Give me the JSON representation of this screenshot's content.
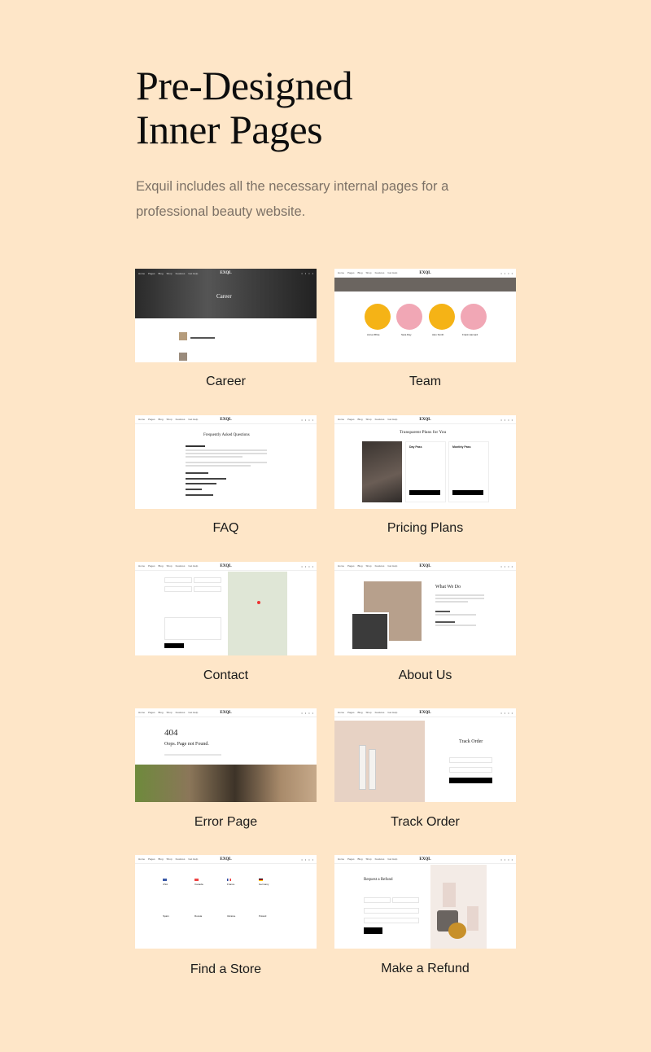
{
  "header": {
    "title_line1": "Pre-Designed",
    "title_line2": "Inner Pages",
    "subtitle": "Exquil includes all the necessary internal pages for a professional beauty website."
  },
  "thumb_nav": {
    "logo": "EXQL",
    "links": [
      "Home",
      "Pages",
      "Blog",
      "Shop",
      "Features",
      "Get Help"
    ]
  },
  "colors": {
    "background": "#fee6c8",
    "title": "#0d0d0d",
    "subtitle": "#7c7166"
  },
  "pages": [
    {
      "label": "Career",
      "heading": "Career"
    },
    {
      "label": "Team",
      "members": [
        "Anna White",
        "Sara Ray",
        "Alex Smith",
        "Frank Harvard"
      ]
    },
    {
      "label": "FAQ",
      "heading": "Frequently Asked Questions"
    },
    {
      "label": "Pricing Plans",
      "heading": "Transparent Plans for You",
      "plans": [
        "Day Pass",
        "Monthly Pass"
      ]
    },
    {
      "label": "Contact"
    },
    {
      "label": "About Us",
      "heading": "What We Do"
    },
    {
      "label": "Error Page",
      "code": "404",
      "message": "Oops. Page not Found."
    },
    {
      "label": "Track Order",
      "heading": "Track Order"
    },
    {
      "label": "Find a Store",
      "countries": [
        "USA",
        "Canada",
        "France",
        "Germany",
        "Spain",
        "Russia",
        "Ukraine",
        "Poland"
      ]
    },
    {
      "label": "Make a Refund",
      "heading": "Request a Refund"
    }
  ]
}
